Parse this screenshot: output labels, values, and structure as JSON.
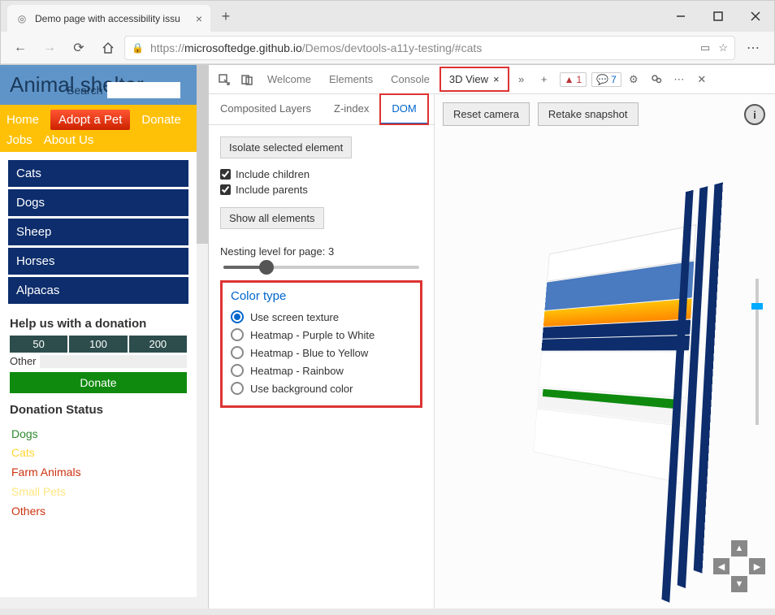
{
  "browser": {
    "tab_title": "Demo page with accessibility issu",
    "url_proto": "https://",
    "url_host": "microsoftedge.github.io",
    "url_path": "/Demos/devtools-a11y-testing/#cats"
  },
  "page": {
    "title": "Animal shelter",
    "search_label": "Search",
    "nav": {
      "home": "Home",
      "adopt": "Adopt a Pet",
      "donate": "Donate",
      "jobs": "Jobs",
      "about": "About Us"
    },
    "animals": [
      "Cats",
      "Dogs",
      "Sheep",
      "Horses",
      "Alpacas"
    ],
    "donation_heading": "Help us with a donation",
    "donation_amounts": [
      "50",
      "100",
      "200"
    ],
    "other_label": "Other",
    "donate_button": "Donate",
    "status_heading": "Donation Status",
    "status_items": {
      "dogs": "Dogs",
      "cats": "Cats",
      "farm": "Farm Animals",
      "small": "Small Pets",
      "others": "Others"
    }
  },
  "devtools": {
    "tabs": {
      "welcome": "Welcome",
      "elements": "Elements",
      "console": "Console",
      "view3d": "3D View"
    },
    "badge_err": "1",
    "badge_info": "7",
    "subtabs": {
      "composited": "Composited Layers",
      "zindex": "Z-index",
      "dom": "DOM"
    },
    "isolate_btn": "Isolate selected element",
    "include_children": "Include children",
    "include_parents": "Include parents",
    "show_all_btn": "Show all elements",
    "nesting_label": "Nesting level for page: 3",
    "color_type_heading": "Color type",
    "color_options": [
      "Use screen texture",
      "Heatmap - Purple to White",
      "Heatmap - Blue to Yellow",
      "Heatmap - Rainbow",
      "Use background color"
    ],
    "reset_camera": "Reset camera",
    "retake_snapshot": "Retake snapshot"
  }
}
